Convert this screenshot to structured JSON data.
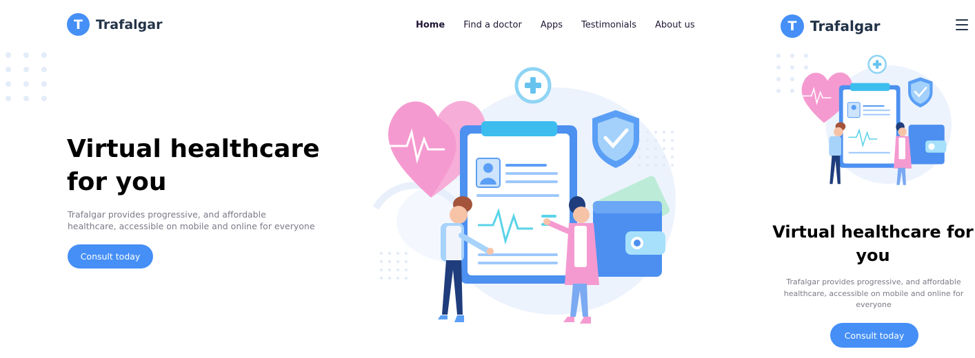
{
  "brand": {
    "name": "Trafalgar",
    "initial": "T",
    "accent_color": "#458ff6"
  },
  "nav": {
    "items": [
      {
        "label": "Home",
        "active": true
      },
      {
        "label": "Find a doctor",
        "active": false
      },
      {
        "label": "Apps",
        "active": false
      },
      {
        "label": "Testimonials",
        "active": false
      },
      {
        "label": "About us",
        "active": false
      }
    ]
  },
  "hero": {
    "title_line1": "Virtual healthcare",
    "title_line2": "for you",
    "description": "Trafalgar provides progressive, and affordable healthcare, accessible on mobile and online for everyone",
    "cta_label": "Consult today"
  },
  "mobile": {
    "title": "Virtual healthcare for you",
    "description": "Trafalgar provides progressive, and affordable healthcare, accessible on mobile and online for everyone",
    "cta_label": "Consult today",
    "menu_icon": "hamburger-icon"
  },
  "illustration": {
    "subject": "doctor and patient with medical clipboard, heart, shield and wallet"
  }
}
